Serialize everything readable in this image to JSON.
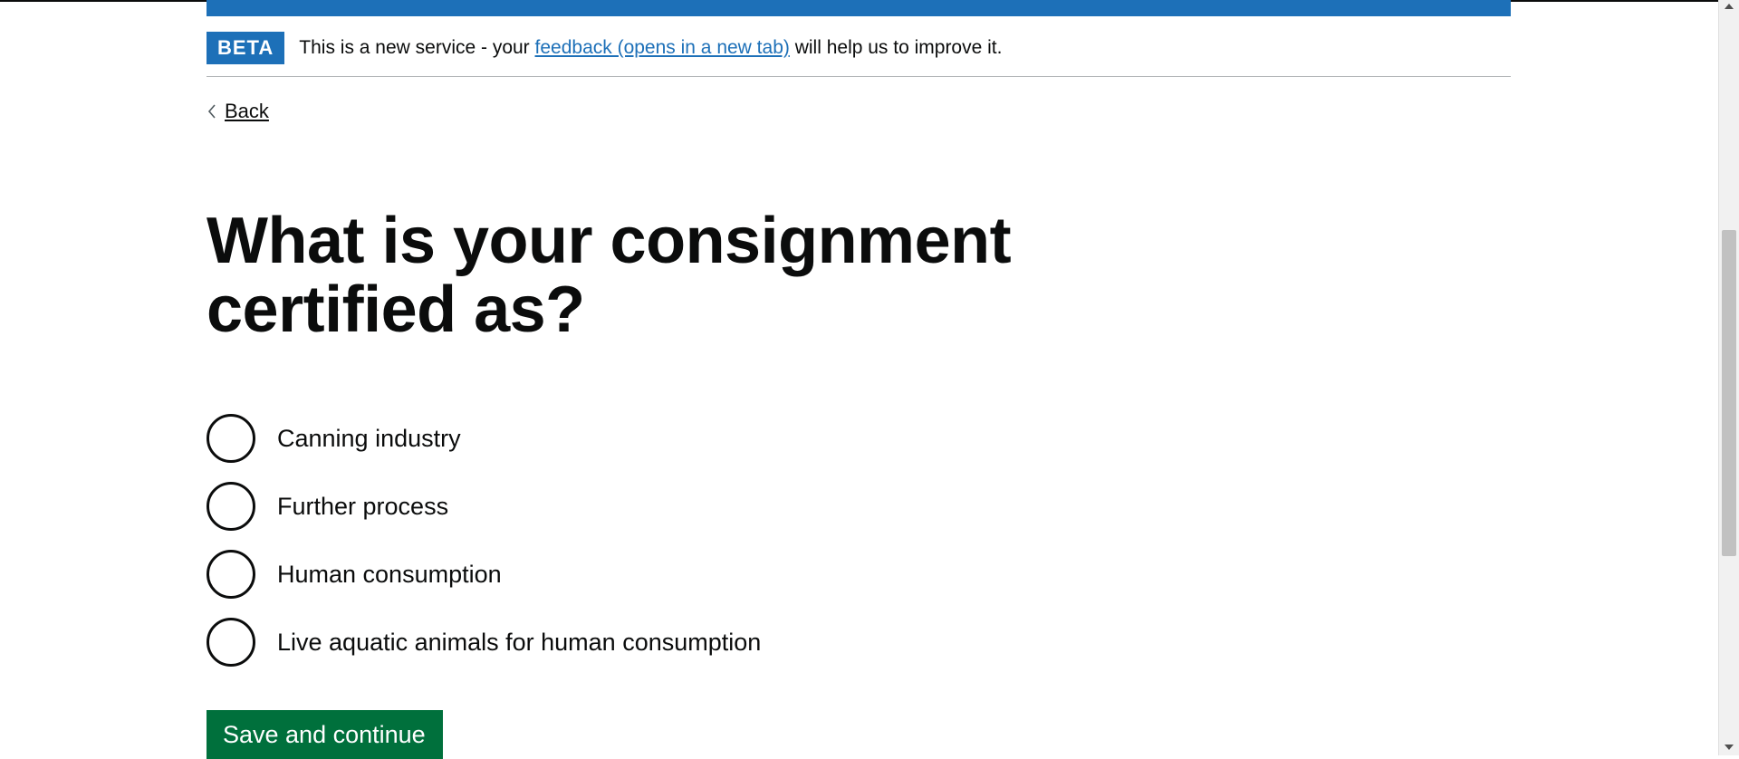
{
  "phase_banner": {
    "tag": "BETA",
    "text_before": "This is a new service - your ",
    "link_text": "feedback (opens in a new tab)",
    "text_after": " will help us to improve it."
  },
  "back_link": {
    "label": "Back"
  },
  "question": {
    "title": "What is your consignment certified as?"
  },
  "options": [
    {
      "label": "Canning industry",
      "selected": false
    },
    {
      "label": "Further process",
      "selected": false
    },
    {
      "label": "Human consumption",
      "selected": false
    },
    {
      "label": "Live aquatic animals for human consumption",
      "selected": false
    }
  ],
  "actions": {
    "save_label": "Save and continue"
  },
  "colors": {
    "brand_blue": "#1d70b8",
    "button_green": "#00703c",
    "text": "#0b0c0c"
  }
}
